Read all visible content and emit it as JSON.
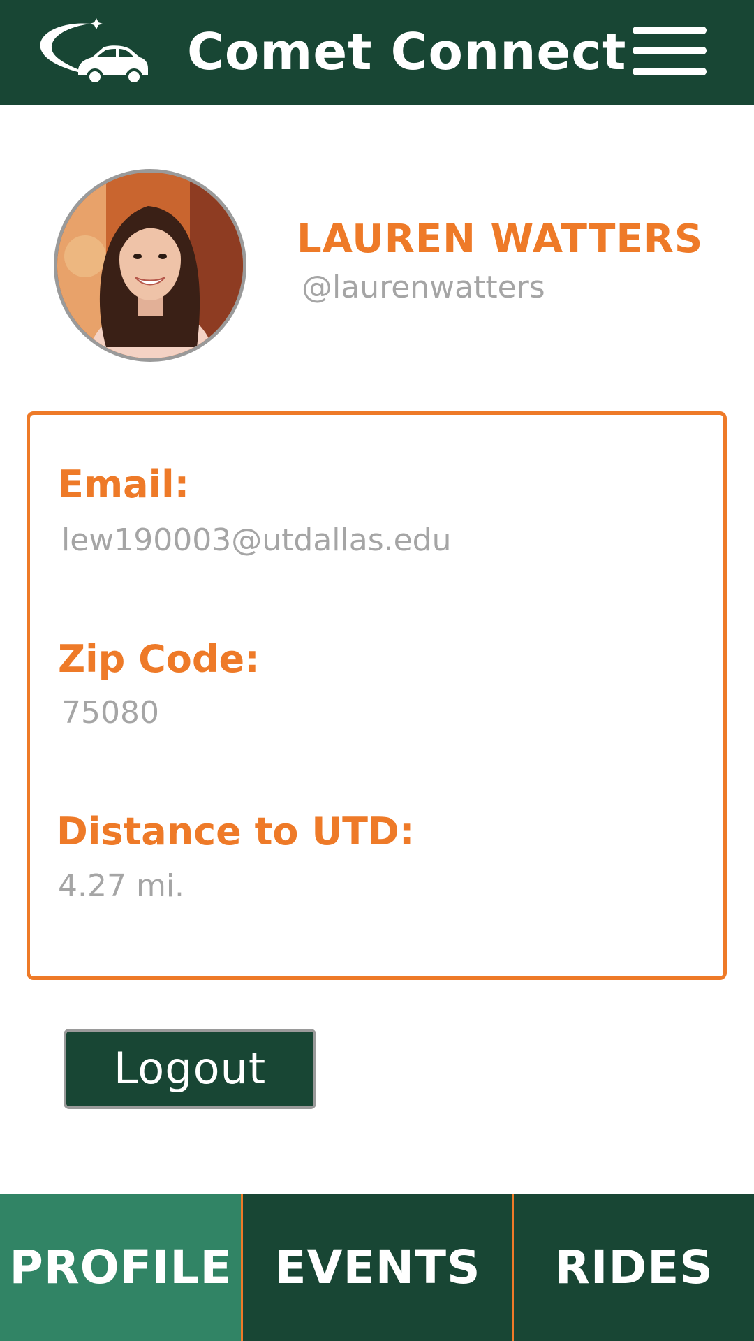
{
  "header": {
    "title": "Comet Connect",
    "logo_icon": "comet-car-logo-icon",
    "menu_icon": "hamburger-menu-icon"
  },
  "profile": {
    "name": "LAUREN WATTERS",
    "handle": "@laurenwatters",
    "avatar": "profile-photo"
  },
  "info": {
    "email_label": "Email:",
    "email_value": "lew190003@utdallas.edu",
    "zip_label": "Zip Code:",
    "zip_value": "75080",
    "distance_label": "Distance to UTD:",
    "distance_value": "4.27 mi."
  },
  "logout_label": "Logout",
  "nav": {
    "tabs": [
      {
        "label": "PROFILE",
        "active": true
      },
      {
        "label": "EVENTS",
        "active": false
      },
      {
        "label": "RIDES",
        "active": false
      }
    ]
  },
  "colors": {
    "primary_green": "#184634",
    "active_tab_green": "#318465",
    "accent_orange": "#EE7A28",
    "muted_gray": "#A5A5A5"
  }
}
